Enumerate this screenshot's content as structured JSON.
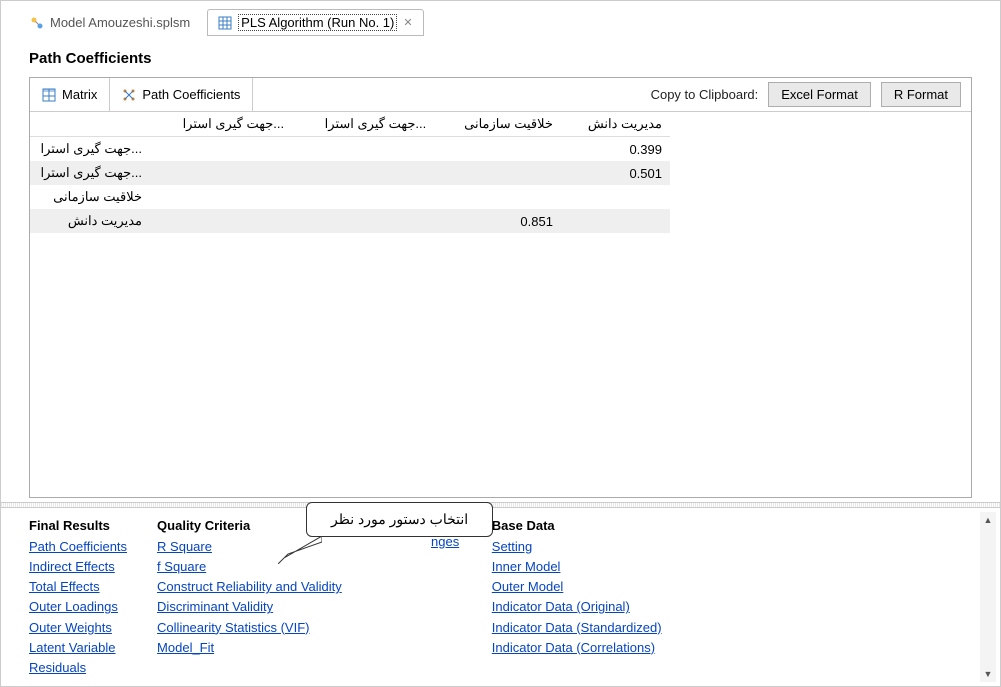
{
  "tabs": {
    "file": "Model Amouzeshi.splsm",
    "result": "PLS Algorithm (Run No. 1)"
  },
  "page_title": "Path Coefficients",
  "panel_tabs": {
    "matrix": "Matrix",
    "pathcoef": "Path Coefficients"
  },
  "clipboard": {
    "label": "Copy to Clipboard:",
    "excel": "Excel Format",
    "r": "R Format"
  },
  "matrix": {
    "headers": [
      "",
      "جهت گیری استرا...",
      "جهت گیری استرا...",
      "خلاقیت سازمانی",
      "مدیریت دانش"
    ],
    "rows": [
      {
        "label": "جهت گیری استرا...",
        "cells": [
          "",
          "",
          "",
          "0.399"
        ],
        "stripe": false
      },
      {
        "label": "جهت گیری استرا...",
        "cells": [
          "",
          "",
          "",
          "0.501"
        ],
        "stripe": true
      },
      {
        "label": "خلاقیت سازمانی",
        "cells": [
          "",
          "",
          "",
          ""
        ],
        "stripe": false
      },
      {
        "label": "مدیریت دانش",
        "cells": [
          "",
          "",
          "0.851",
          ""
        ],
        "stripe": true
      }
    ]
  },
  "bottom": {
    "final_results": {
      "title": "Final Results",
      "links": [
        "Path Coefficients",
        "Indirect Effects",
        "Total Effects",
        "Outer Loadings",
        "Outer Weights",
        "Latent Variable",
        "Residuals"
      ]
    },
    "quality": {
      "title": "Quality Criteria",
      "links": [
        "R Square",
        "f Square",
        "Construct Reliability and Validity",
        "Discriminant Validity",
        "Collinearity Statistics (VIF)",
        "Model_Fit"
      ]
    },
    "hidden_link": "nges",
    "base": {
      "title": "Base Data",
      "links": [
        "Setting",
        "Inner Model",
        "Outer Model",
        "Indicator Data (Original)",
        "Indicator Data (Standardized)",
        "Indicator Data (Correlations)"
      ]
    }
  },
  "callout_text": "انتخاب دستور مورد نظر"
}
